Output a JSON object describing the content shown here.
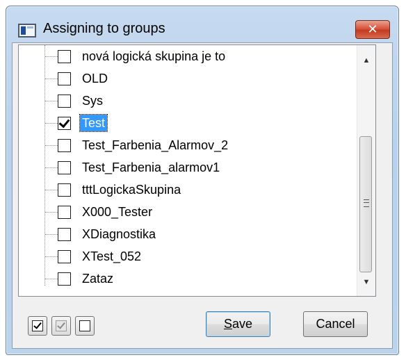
{
  "window": {
    "title": "Assigning to groups",
    "close_glyph": "✕"
  },
  "tree": {
    "items": [
      {
        "label": "nová logická skupina je to",
        "checked": false,
        "selected": false
      },
      {
        "label": "OLD",
        "checked": false,
        "selected": false
      },
      {
        "label": "Sys",
        "checked": false,
        "selected": false
      },
      {
        "label": "Test",
        "checked": true,
        "selected": true
      },
      {
        "label": "Test_Farbenia_Alarmov_2",
        "checked": false,
        "selected": false
      },
      {
        "label": "Test_Farbenia_alarmov1",
        "checked": false,
        "selected": false
      },
      {
        "label": "tttLogickaSkupina",
        "checked": false,
        "selected": false
      },
      {
        "label": "X000_Tester",
        "checked": false,
        "selected": false
      },
      {
        "label": "XDiagnostika",
        "checked": false,
        "selected": false
      },
      {
        "label": "XTest_052",
        "checked": false,
        "selected": false
      },
      {
        "label": "Zataz",
        "checked": false,
        "selected": false
      }
    ],
    "scroll_up_glyph": "▲",
    "scroll_down_glyph": "▼"
  },
  "buttons": {
    "save_accel": "S",
    "save_rest": "ave",
    "cancel": "Cancel"
  },
  "colors": {
    "selection": "#3399ff",
    "title_bg": "#bcd3ec",
    "close": "#c43a22"
  }
}
